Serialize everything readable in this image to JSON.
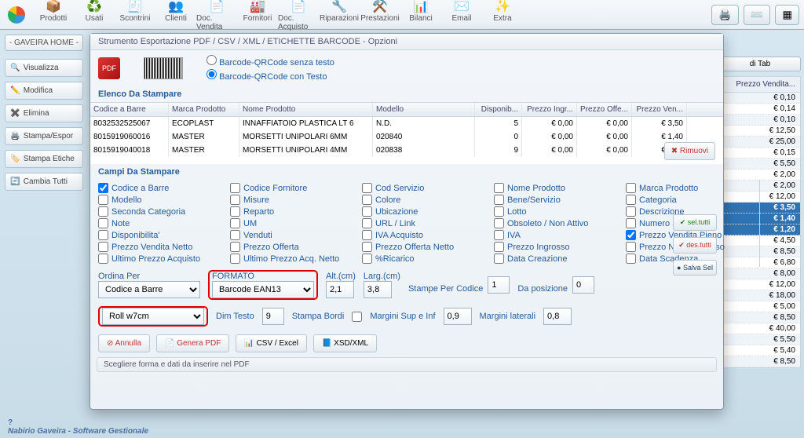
{
  "toolbar": {
    "items": [
      {
        "icon": "📦",
        "label": "Prodotti"
      },
      {
        "icon": "♻️",
        "label": "Usati"
      },
      {
        "icon": "🧾",
        "label": "Scontrini"
      },
      {
        "icon": "👥",
        "label": "Clienti"
      },
      {
        "icon": "📄",
        "label": "Doc. Vendita"
      },
      {
        "icon": "🏭",
        "label": "Fornitori"
      },
      {
        "icon": "📄",
        "label": "Doc. Acquisto"
      },
      {
        "icon": "🔧",
        "label": "Riparazioni"
      },
      {
        "icon": "⚒️",
        "label": "Prestazioni"
      },
      {
        "icon": "📊",
        "label": "Bilanci"
      },
      {
        "icon": "✉️",
        "label": "Email"
      },
      {
        "icon": "✨",
        "label": "Extra"
      }
    ]
  },
  "sidebar": {
    "home": "- GAVEIRA HOME -",
    "buttons": [
      {
        "icon": "🔍",
        "label": "Visualizza"
      },
      {
        "icon": "✏️",
        "label": "Modifica"
      },
      {
        "icon": "✖️",
        "label": "Elimina"
      },
      {
        "icon": "🖨️",
        "label": "Stampa/Espor"
      },
      {
        "icon": "🏷️",
        "label": "Stampa Etiche"
      },
      {
        "icon": "🔄",
        "label": "Cambia Tutti"
      }
    ]
  },
  "right": {
    "tab": "di Tab",
    "header": "Prezzo Vendita...",
    "prices": [
      "€ 0,10",
      "€ 0,14",
      "€ 0,10",
      "€ 12,50",
      "€ 25,00",
      "€ 0,15",
      "€ 5,50",
      "€ 2,00",
      "€ 2,00",
      "€ 12,00",
      "€ 3,50",
      "€ 1,40",
      "€ 1,20",
      "€ 4,50",
      "€ 8,50",
      "€ 6,80",
      "€ 8,00",
      "€ 12,00",
      "€ 18,00",
      "€ 5,00",
      "€ 8,50",
      "€ 40,00",
      "€ 5,50",
      "€ 5,40",
      "€ 8,50"
    ],
    "selected": [
      10,
      11,
      12
    ]
  },
  "dialog": {
    "title": "Strumento Esportazione PDF / CSV / XML / ETICHETTE BARCODE - Opzioni",
    "radio_no_text": "Barcode-QRCode senza testo",
    "radio_with_text": "Barcode-QRCode con Testo",
    "elenco_header": "Elenco Da Stampare",
    "cols": {
      "codice": "Codice a Barre",
      "marca": "Marca Prodotto",
      "nome": "Nome Prodotto",
      "modello": "Modello",
      "disp": "Disponib...",
      "ingr": "Prezzo Ingr...",
      "off": "Prezzo Offe...",
      "ven": "Prezzo Ven..."
    },
    "rows": [
      {
        "codice": "8032532525067",
        "marca": "ECOPLAST",
        "nome": "INNAFFIATOIO PLASTICA LT 6",
        "modello": "N.D.",
        "disp": "5",
        "ingr": "€ 0,00",
        "off": "€ 0,00",
        "ven": "€ 3,50"
      },
      {
        "codice": "8015919060016",
        "marca": "MASTER",
        "nome": "MORSETTI UNIPOLARI 6MM",
        "modello": "020840",
        "disp": "0",
        "ingr": "€ 0,00",
        "off": "€ 0,00",
        "ven": "€ 1,40"
      },
      {
        "codice": "8015919040018",
        "marca": "MASTER",
        "nome": "MORSETTI UNIPOLARI 4MM",
        "modello": "020838",
        "disp": "9",
        "ingr": "€ 0,00",
        "off": "€ 0,00",
        "ven": "€ 1,20"
      }
    ],
    "rimuovi": "Rimuovi",
    "campi_header": "Campi Da Stampare",
    "fields": [
      [
        "Codice a Barre",
        "Codice Fornitore",
        "Cod Servizio",
        "Nome Prodotto",
        "Marca Prodotto"
      ],
      [
        "Modello",
        "Misure",
        "Colore",
        "Bene/Servizio",
        "Categoria"
      ],
      [
        "Seconda Categoria",
        "Reparto",
        "Ubicazione",
        "Lotto",
        "Descrizione"
      ],
      [
        "Note",
        "UM",
        "URL / Link",
        "Obsoleto / Non Attivo",
        "Numero Sottoscorta"
      ],
      [
        "Disponibilita'",
        "Venduti",
        "IVA Acquisto",
        "IVA",
        "Prezzo Vendita Pieno"
      ],
      [
        "Prezzo Vendita Netto",
        "Prezzo Offerta",
        "Prezzo Offerta Netto",
        "Prezzo Ingrosso",
        "Prezzo Netto Ingrosso"
      ],
      [
        "Ultimo Prezzo Acquisto",
        "Ultimo Prezzo Acq. Netto",
        "%Ricarico",
        "Data Creazione",
        "Data Scadenza"
      ]
    ],
    "checked": {
      "Codice a Barre": true,
      "Prezzo Vendita Pieno": true
    },
    "actions": {
      "sel": "sel.tutti",
      "des": "des.tutti",
      "salva": "Salva Sel"
    },
    "labels": {
      "ordina": "Ordina Per",
      "formato": "FORMATO",
      "alt": "Alt.(cm)",
      "larg": "Larg.(cm)",
      "stampe": "Stampe Per Codice",
      "dapos": "Da posizione",
      "dim": "Dim Testo",
      "bordi": "Stampa Bordi",
      "margtb": "Margini Sup e Inf",
      "marglat": "Margini laterali"
    },
    "values": {
      "ordina": "Codice a Barre",
      "formato": "Barcode EAN13",
      "roll": "Roll w7cm",
      "alt": "2,1",
      "larg": "3,8",
      "stampe": "1",
      "dapos": "0",
      "dim": "9",
      "margtb": "0,9",
      "marglat": "0,8"
    },
    "bottom": {
      "annulla": "Annulla",
      "genera": "Genera PDF",
      "csv": "CSV / Excel",
      "xsd": "XSD/XML"
    },
    "hint": "Scegliere forma e dati da inserire nel PDF"
  },
  "footer": {
    "q": "?",
    "text": "Nabirio Gaveira - Software Gestionale"
  }
}
